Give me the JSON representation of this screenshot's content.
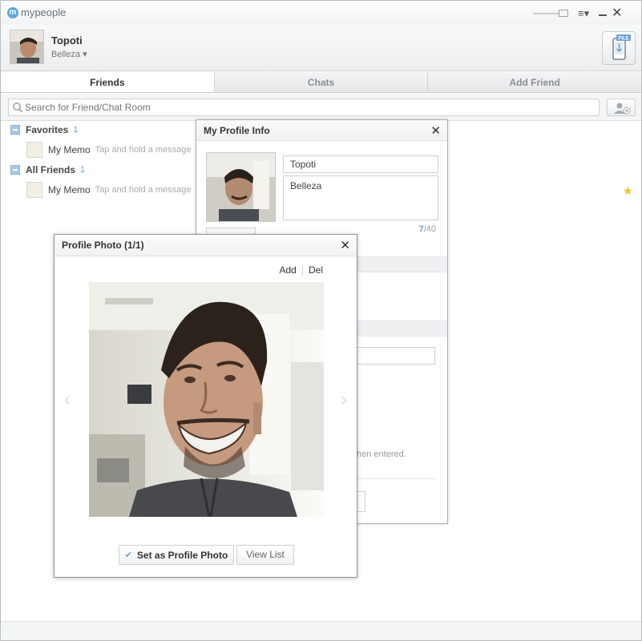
{
  "app": {
    "title": "mypeople",
    "logo_letter": "m"
  },
  "header": {
    "user_name": "Topoti",
    "user_status": "Belleza",
    "file_badge": "FILE"
  },
  "tabs": [
    {
      "label": "Friends",
      "active": true
    },
    {
      "label": "Chats",
      "active": false
    },
    {
      "label": "Add Friend",
      "active": false
    }
  ],
  "search": {
    "placeholder": "Search for Friend/Chat Room"
  },
  "groups": [
    {
      "name": "Favorites",
      "count": "1",
      "items": [
        {
          "name": "My Memo",
          "message": "Tap and hold a message"
        }
      ]
    },
    {
      "name": "All Friends",
      "count": "1",
      "items": [
        {
          "name": "My Memo",
          "message": "Tap and hold a message"
        }
      ]
    }
  ],
  "profile_info": {
    "title": "My Profile Info",
    "name_value": "Topoti",
    "status_value": "Belleza",
    "counter_current": "7",
    "counter_max": "/40",
    "hint_fragment": "hen entered."
  },
  "profile_photo": {
    "title": "Profile Photo (1/1)",
    "add_label": "Add",
    "del_label": "Del",
    "set_label": "Set as Profile Photo",
    "view_list_label": "View List"
  },
  "colors": {
    "accent": "#6da3d6",
    "star": "#f2c21a",
    "border": "#cdd0d3"
  }
}
